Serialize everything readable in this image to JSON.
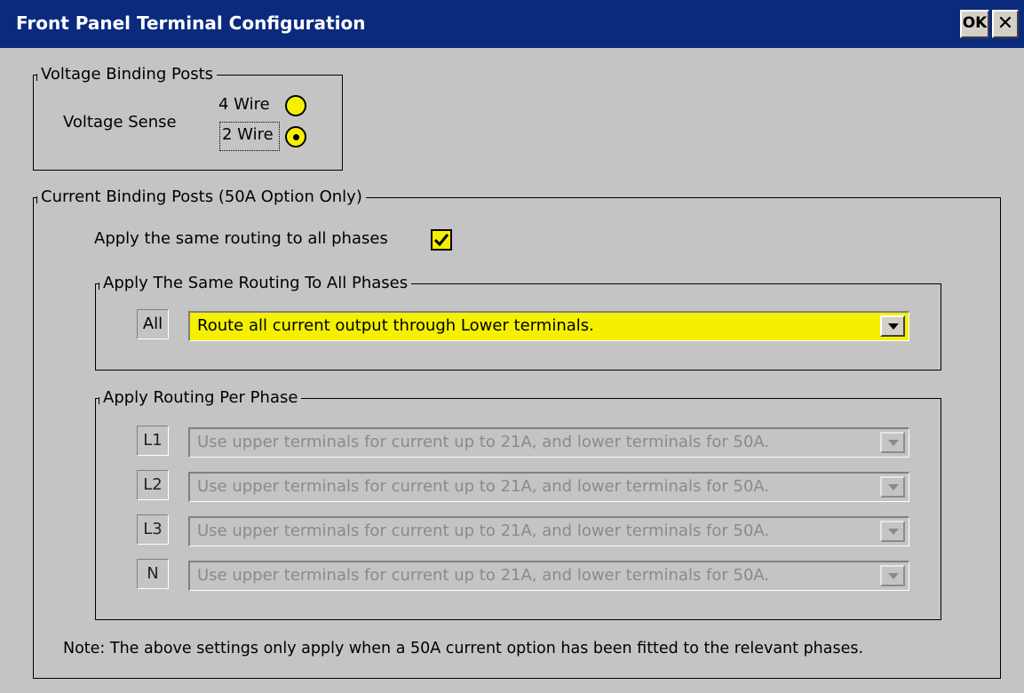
{
  "window": {
    "title": "Front Panel Terminal Configuration",
    "ok_label": "OK",
    "close_label": "✕"
  },
  "voltage": {
    "group_title": "Voltage Binding Posts",
    "sense_label": "Voltage Sense",
    "options": [
      {
        "label": "4 Wire",
        "selected": false
      },
      {
        "label": "2 Wire",
        "selected": true
      }
    ]
  },
  "current": {
    "group_title": "Current Binding Posts (50A Option Only)",
    "same_routing_label": "Apply the same routing to all phases",
    "same_routing_checked": true,
    "all_group": {
      "title": "Apply The Same Routing To All Phases",
      "phase": "All",
      "value": "Route all current output through Lower terminals."
    },
    "per_phase_group": {
      "title": "Apply Routing Per Phase",
      "rows": [
        {
          "phase": "L1",
          "value": "Use upper terminals for current up to 21A, and lower terminals for 50A."
        },
        {
          "phase": "L2",
          "value": "Use upper terminals for current up to 21A, and lower terminals for 50A."
        },
        {
          "phase": "L3",
          "value": "Use upper terminals for current up to 21A, and lower terminals for 50A."
        },
        {
          "phase": "N",
          "value": "Use upper terminals for current up to 21A, and lower terminals for 50A."
        }
      ]
    },
    "note": "Note: The above settings only apply when a 50A current option has been fitted to the relevant phases."
  },
  "colors": {
    "titlebar": "#0a2a7e",
    "background": "#c4c4c4",
    "highlight": "#f5f000"
  }
}
